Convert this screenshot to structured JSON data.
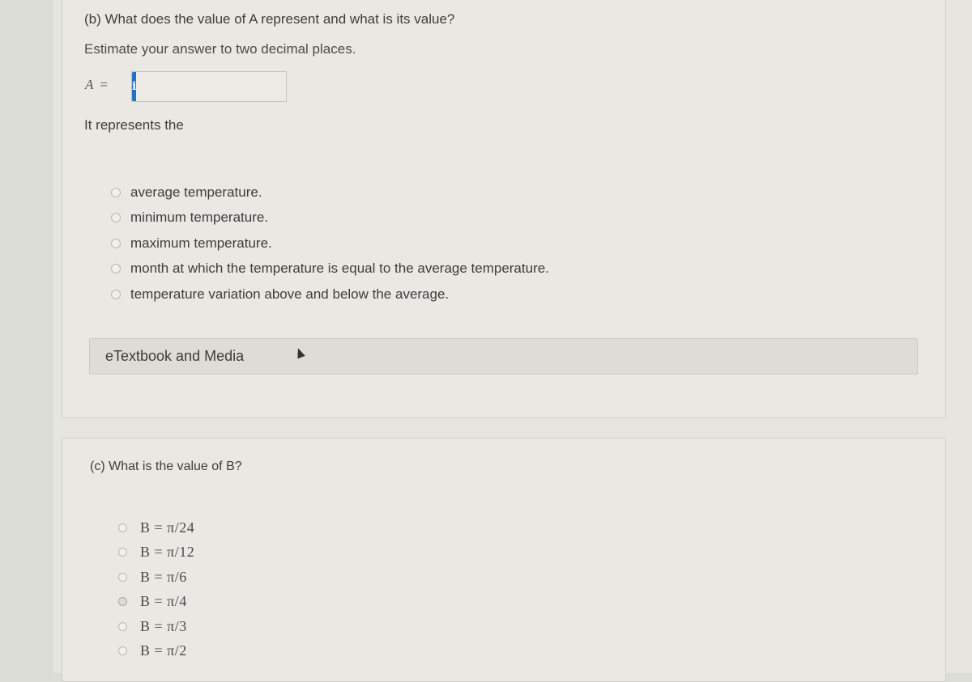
{
  "part_b": {
    "question": "(b) What does the value of A represent and what is its value?",
    "instruction": "Estimate your answer to two decimal places.",
    "answer_label": "A",
    "answer_equals": "=",
    "info_icon": "i",
    "answer_value": "",
    "represents_prompt": "It represents the",
    "options": [
      {
        "label": "average temperature."
      },
      {
        "label": "minimum temperature."
      },
      {
        "label": "maximum temperature."
      },
      {
        "label": "month at which the temperature is equal to the average temperature."
      },
      {
        "label": "temperature variation above and below the average."
      }
    ],
    "resources_label": "eTextbook and Media"
  },
  "part_c": {
    "question": "(c) What is the value of B?",
    "options": [
      {
        "label": "B = π/24"
      },
      {
        "label": "B = π/12"
      },
      {
        "label": "B = π/6"
      },
      {
        "label": "B = π/4"
      },
      {
        "label": "B = π/3"
      },
      {
        "label": "B = π/2"
      }
    ]
  },
  "colors": {
    "info_button": "#2170c9",
    "page_background": "#e6e5e0"
  }
}
